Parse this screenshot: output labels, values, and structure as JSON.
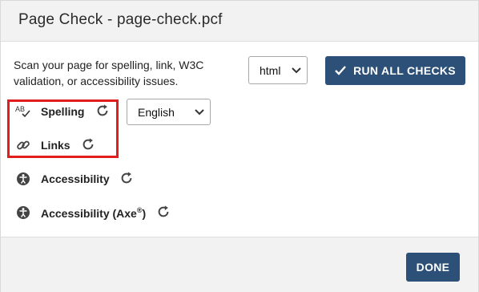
{
  "dialog": {
    "title": "Page Check - page-check.pcf",
    "description": "Scan your page for spelling, link, W3C validation, or accessibility issues."
  },
  "format_select": {
    "value": "html"
  },
  "run_button": {
    "label": "RUN ALL CHECKS",
    "icon": "checkmark-icon"
  },
  "checks": [
    {
      "label": "Spelling",
      "icon": "spellcheck-icon"
    },
    {
      "label": "Links",
      "icon": "link-icon"
    },
    {
      "label": "Accessibility",
      "icon": "accessibility-icon"
    },
    {
      "label": "Accessibility (Axe",
      "suffix": "®",
      "suffix_end": ")",
      "icon": "accessibility-icon"
    }
  ],
  "language_select": {
    "value": "English"
  },
  "footer": {
    "done_label": "DONE"
  },
  "colors": {
    "primary": "#2c5077",
    "highlight": "#e11d1d"
  }
}
